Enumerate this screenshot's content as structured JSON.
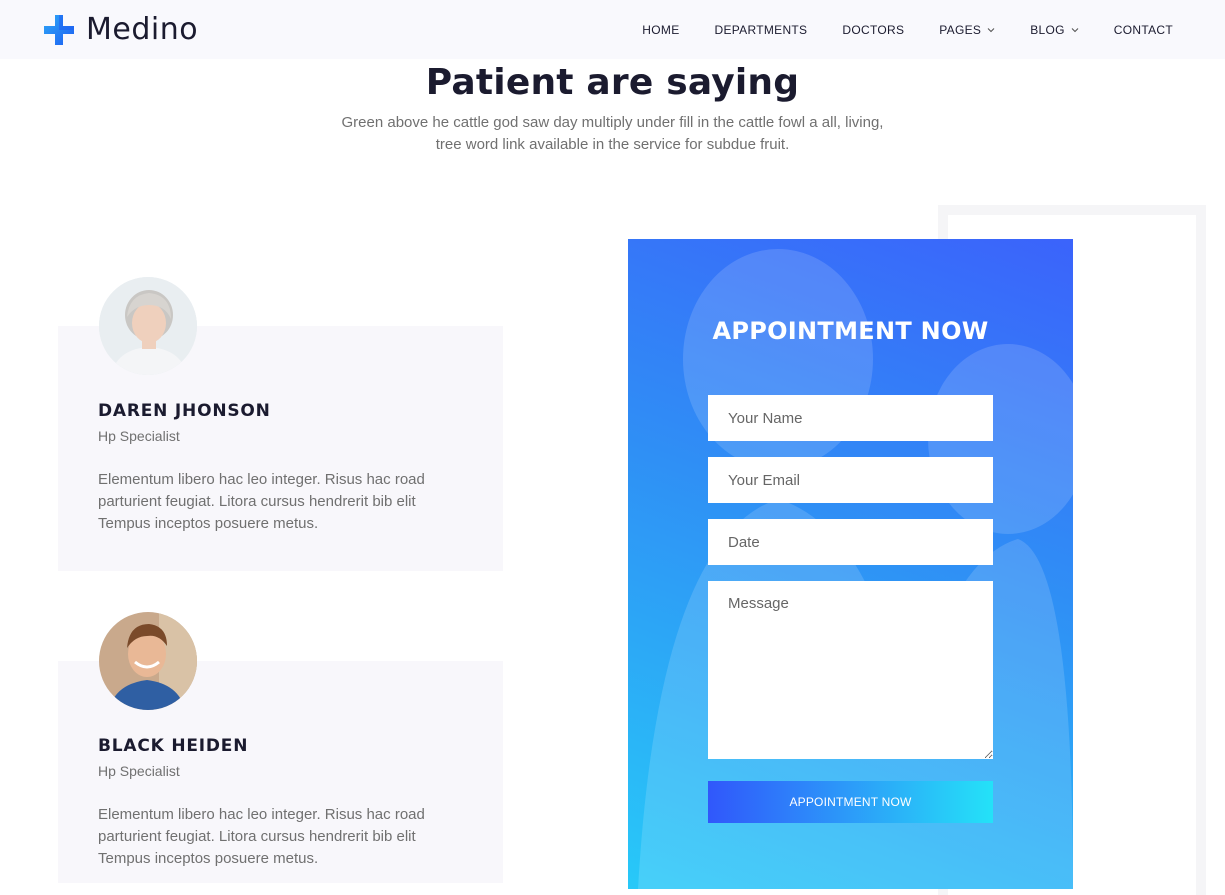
{
  "brand": {
    "name": "Medino",
    "accent": "#3b63fb"
  },
  "nav": {
    "home": "HOME",
    "departments": "DEPARTMENTS",
    "doctors": "DOCTORS",
    "pages": "PAGES",
    "blog": "BLOG",
    "contact": "CONTACT"
  },
  "testimonials": {
    "title": "Patient are saying",
    "subtitle": "Green above he cattle god saw day multiply under fill in the cattle fowl a all, living, tree word link available in the service for subdue fruit.",
    "items": [
      {
        "name": "DAREN JHONSON",
        "role": "Hp Specialist",
        "quote": "Elementum libero hac leo integer. Risus hac road parturient feugiat. Litora cursus hendrerit bib elit Tempus inceptos posuere metus."
      },
      {
        "name": "BLACK HEIDEN",
        "role": "Hp Specialist",
        "quote": "Elementum libero hac leo integer. Risus hac road parturient feugiat. Litora cursus hendrerit bib elit Tempus inceptos posuere metus."
      }
    ]
  },
  "appointment": {
    "title": "APPOINTMENT NOW",
    "name_placeholder": "Your Name",
    "email_placeholder": "Your Email",
    "date_placeholder": "Date",
    "message_placeholder": "Message",
    "submit_label": "APPOINTMENT NOW",
    "gradient_start": "#3b63fb",
    "gradient_end": "#28c9f8"
  }
}
